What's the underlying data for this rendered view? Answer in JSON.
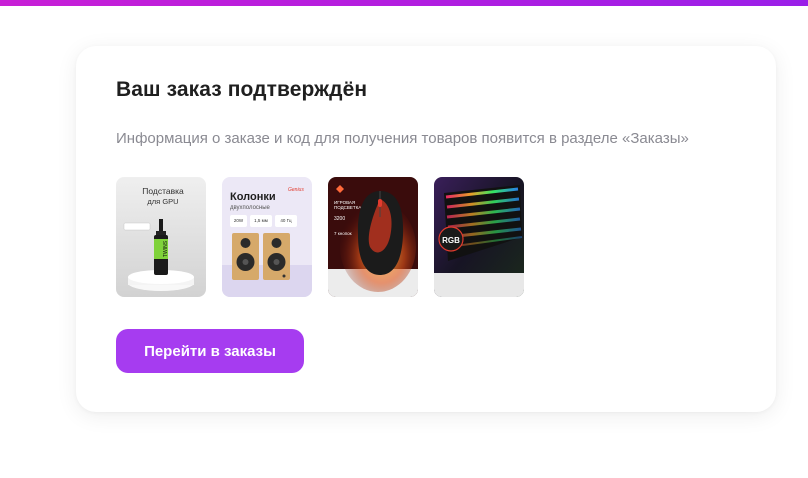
{
  "order": {
    "title": "Ваш заказ подтверждён",
    "subtitle": "Информация о заказе и код для получения товаров появится в разделе «Заказы»",
    "button_label": "Перейти в заказы"
  },
  "products": [
    {
      "icon": "gpu-support-stand-image",
      "lines": [
        "Подставка",
        "для GPU"
      ],
      "tag": "TWINS"
    },
    {
      "icon": "speakers-image",
      "title": "Колонки",
      "subtitle": "двухполосные",
      "brand": "Genius",
      "specs": [
        "20W",
        "1,5 мм",
        "40 Гц"
      ]
    },
    {
      "icon": "gaming-mouse-image",
      "lines": [
        "ИГРОВАЯ",
        "ПОДСВЕТКА"
      ],
      "dpi": "3200",
      "buttons": "7 кнопок"
    },
    {
      "icon": "rgb-keyboard-image",
      "badge": "RGB"
    }
  ],
  "colors": {
    "accent": "#a63cf0",
    "topbar": "#c81fd6",
    "title": "#1f1f1f",
    "subtitle": "#8a8a92"
  }
}
